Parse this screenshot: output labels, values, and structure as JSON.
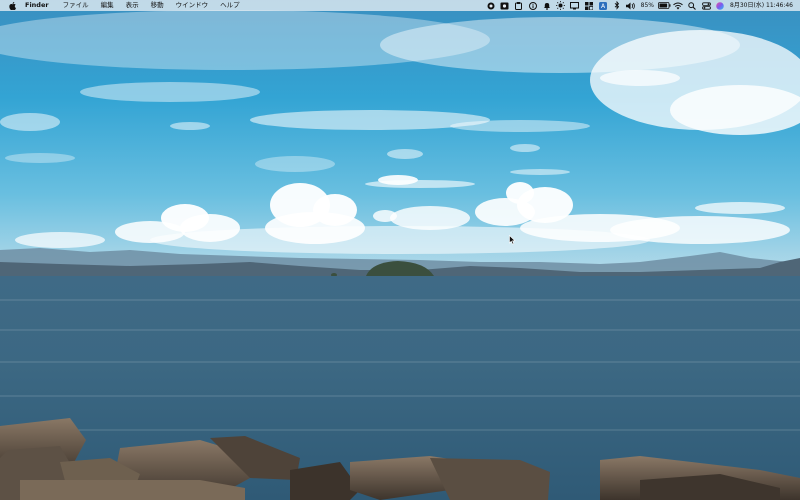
{
  "menubar": {
    "app_name": "Finder",
    "menus": [
      "ファイル",
      "編集",
      "表示",
      "移動",
      "ウインドウ",
      "ヘルプ"
    ],
    "battery": "85%",
    "clock": "8月30日(水)  11:46:46"
  },
  "status_icons": [
    "record-icon",
    "screenshot-icon",
    "clipboard-icon",
    "info-icon",
    "bell-icon",
    "brightness-icon",
    "display-icon",
    "grid-icon",
    "keyboard-icon",
    "bluetooth-icon",
    "volume-icon",
    "battery-icon",
    "wifi-icon",
    "search-icon",
    "control-center-icon",
    "siri-icon"
  ],
  "colors": {
    "sky_top": "#2f8fc4",
    "sky_bottom": "#8fc9e6",
    "sea": "#3d6a86",
    "menubar_bg": "#e8eef4"
  }
}
